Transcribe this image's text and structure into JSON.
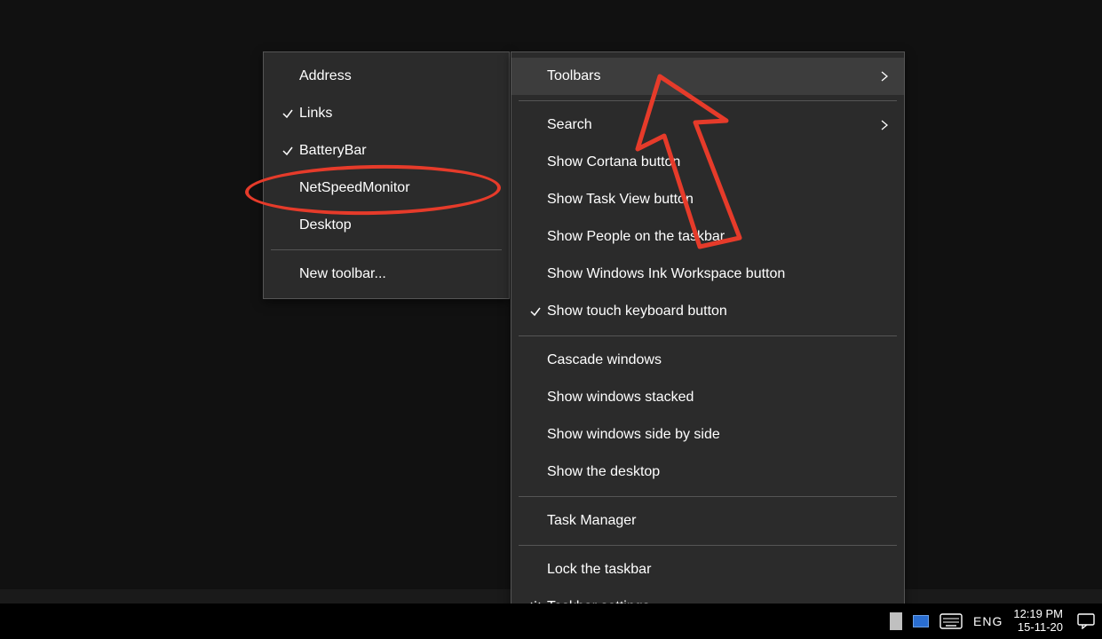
{
  "submenu": {
    "items": [
      {
        "label": "Address",
        "checked": false
      },
      {
        "label": "Links",
        "checked": true
      },
      {
        "label": "BatteryBar",
        "checked": true
      },
      {
        "label": "NetSpeedMonitor",
        "checked": false
      },
      {
        "label": "Desktop",
        "checked": false
      }
    ],
    "new_toolbar_label": "New toolbar..."
  },
  "mainmenu": {
    "toolbars_label": "Toolbars",
    "search_label": "Search",
    "show_cortana_label": "Show Cortana button",
    "show_taskview_label": "Show Task View button",
    "show_people_label": "Show People on the taskbar",
    "show_ink_label": "Show Windows Ink Workspace button",
    "show_touch_kbd_label": "Show touch keyboard button",
    "show_touch_kbd_checked": true,
    "cascade_label": "Cascade windows",
    "stacked_label": "Show windows stacked",
    "sidebyside_label": "Show windows side by side",
    "show_desktop_label": "Show the desktop",
    "task_manager_label": "Task Manager",
    "lock_taskbar_label": "Lock the taskbar",
    "taskbar_settings_label": "Taskbar settings"
  },
  "taskbar": {
    "lang": "ENG",
    "time": "12:19 PM",
    "date": "15-11-20"
  }
}
